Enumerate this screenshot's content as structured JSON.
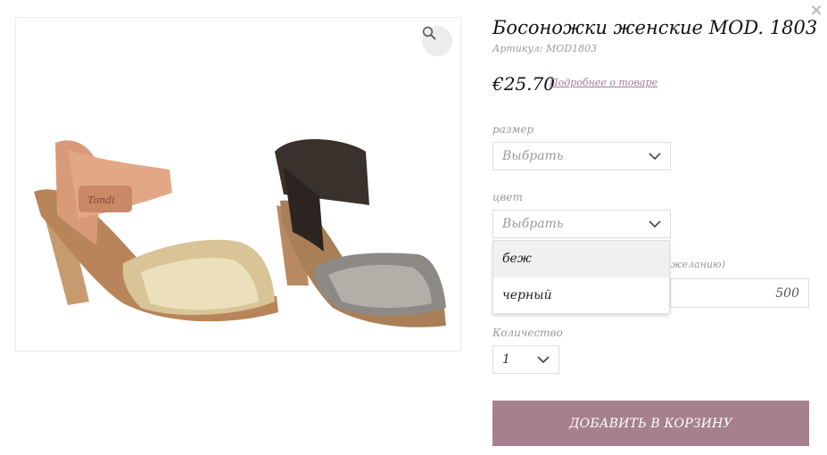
{
  "modal": {
    "close_label": "×"
  },
  "product": {
    "title": "Босоножки женские MOD. 1803",
    "sku_label": "Артикул:",
    "sku_value": "MOD1803",
    "price": "€25.70",
    "details_link": "Подробнее о товаре",
    "image_brand_text": "Tondi"
  },
  "options": {
    "size": {
      "label": "размер",
      "selected": "Выбрать"
    },
    "color": {
      "label": "цвет",
      "selected": "Выбрать",
      "options": [
        "беж",
        "черный"
      ],
      "highlighted_index": 0
    },
    "amount": {
      "partial_label": "желанию)",
      "value": "500"
    },
    "quantity": {
      "label": "Количество",
      "selected": "1"
    }
  },
  "cart": {
    "add_button_label": "ДОБАВИТЬ В КОРЗИНУ"
  },
  "colors": {
    "accent": "#a6808f",
    "link": "#a07d8e",
    "border": "#dddddd"
  },
  "icons": {
    "zoom": "search-icon",
    "close": "close-icon",
    "dropdown": "chevron-down-icon"
  }
}
